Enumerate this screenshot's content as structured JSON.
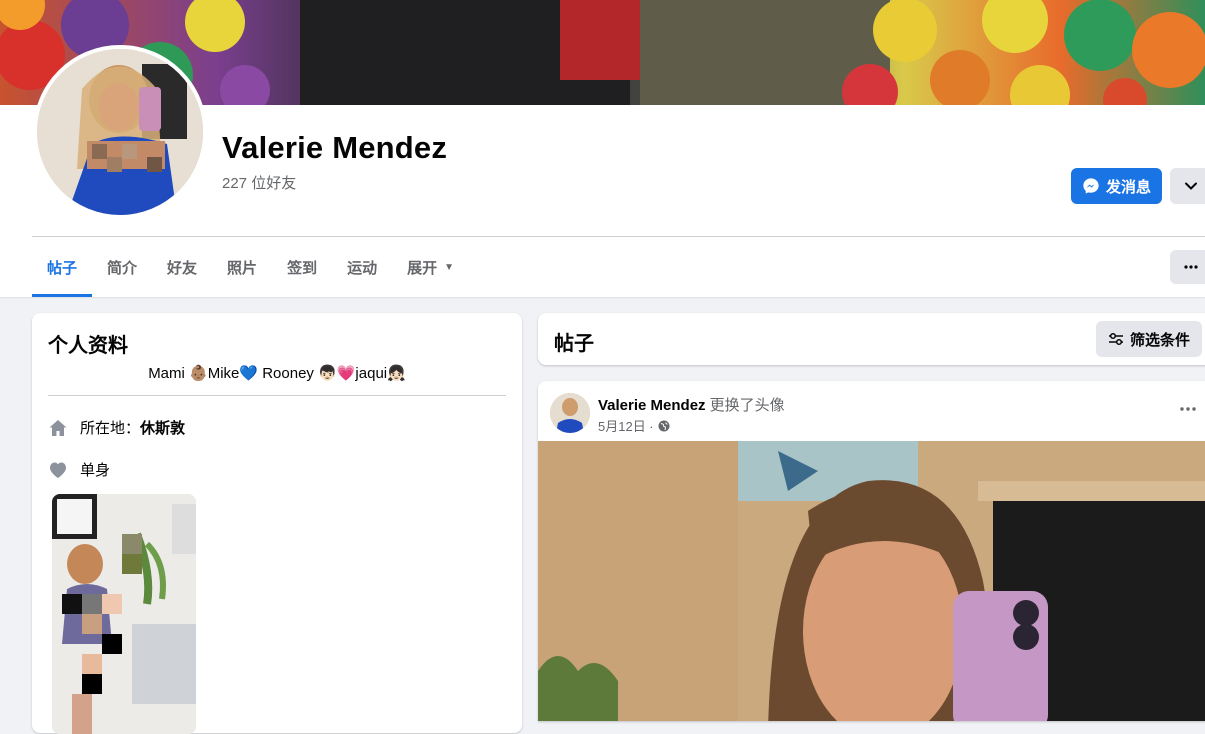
{
  "profile": {
    "name": "Valerie Mendez",
    "friends_count": "227 位好友"
  },
  "actions": {
    "message_label": "发消息",
    "message_icon": "messenger-icon",
    "more_icon": "chevron-down-icon"
  },
  "tabs": [
    {
      "label": "帖子",
      "active": true
    },
    {
      "label": "简介"
    },
    {
      "label": "好友"
    },
    {
      "label": "照片"
    },
    {
      "label": "签到"
    },
    {
      "label": "运动"
    },
    {
      "label": "展开",
      "caret": "▼"
    }
  ],
  "intro": {
    "title": "个人资料",
    "bio": "Mami 👶🏽Mike💙 Rooney 👦🏻💗jaqui👧🏻",
    "location_label": "所在地：",
    "location_value": "休斯敦",
    "relationship": "单身"
  },
  "posts": {
    "title": "帖子",
    "filter_label": "筛选条件"
  },
  "post": {
    "author": "Valerie Mendez",
    "action": "更换了头像",
    "date": "5月12日 ·"
  },
  "colors": {
    "accent": "#1b74e4",
    "background": "#f0f2f5",
    "secondary_text": "#65676b"
  }
}
